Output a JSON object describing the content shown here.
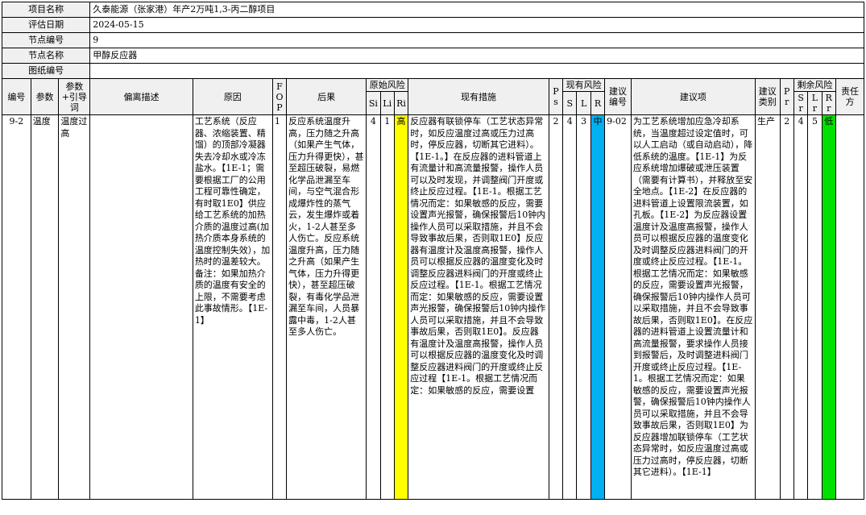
{
  "meta": {
    "project_label": "项目名称",
    "project_value": "久泰能源（张家港）年产2万吨1,3-丙二醇项目",
    "date_label": "评估日期",
    "date_value": "2024-05-15",
    "node_no_label": "节点编号",
    "node_no_value": "9",
    "node_name_label": "节点名称",
    "node_name_value": "甲醇反应器",
    "drawing_label": "图纸编号",
    "drawing_value": ""
  },
  "headers": {
    "no": "编号",
    "param": "参数",
    "param_guide": "参数+引导词",
    "deviation": "偏离描述",
    "cause": "原因",
    "fop": "FOP",
    "consequence": "后果",
    "orig_risk": "原始风险",
    "si": "Si",
    "li": "Li",
    "ri": "Ri",
    "measures": "现有措施",
    "ps": "Ps",
    "cur_risk": "现有风险",
    "s": "S",
    "l": "L",
    "r": "R",
    "rec_no": "建议编号",
    "rec": "建议项",
    "rec_type": "建议类别",
    "pr": "Pr",
    "res_risk": "剩余风险",
    "sr": "Sr",
    "lr": "Lr",
    "rr": "Rr",
    "owner": "责任方"
  },
  "row": {
    "no": "9-2",
    "param": "温度",
    "param_guide": "温度过高",
    "deviation": "",
    "cause": "工艺系统（反应器、浓缩装置、精馏）的顶部冷凝器失去冷却水或冷冻盐水。【1E-1；需要根据工厂的公用工程可靠性确定，有时取1E0】供应给工艺系统的加热介质的温度过高(加热介质本身系统的温度控制失效），加热时的温差较大。备注：如果加热介质的温度有安全的上限，不需要考虑此事故情形。【1E-1】",
    "fop": "1",
    "consequence": "反应系统温度升高，压力随之升高（如果产生气体，压力升得更快），甚至超压破裂，易燃化学品泄漏至车间，与空气混合形成爆炸性的蒸气云，发生爆炸或着火，1-2人甚至多人伤亡。反应系统温度升高，压力随之升高（如果产生气体，压力升得更快），甚至超压破裂，有毒化学品泄漏至车间，人员暴露中毒，1-2人甚至多人伤亡。",
    "si": "4",
    "li": "1",
    "ri": "高",
    "measures": "反应器有联锁停车（工艺状态异常时，如反应温度过高或压力过高时，停反应器，切断其它进料）。【1E-1。】在反应器的进料管道上有流量计和高流量报警，操作人员可以及时发现，并调整阀门开度或终止反应过程。【1E-1。根据工艺情况而定：如果敏感的反应，需要设置声光报警，确保报警后10钟内操作人员可以采取措施，并且不会导致事故后果，否则取1E0】反应器有温度计及温度高报警，操作人员可以根据反应器的温度变化及时调整反应器进料阀门的开度或终止反应过程。【1E-1。根据工艺情况而定：如果敏感的反应，需要设置声光报警，确保报警后10钟内操作人员可以采取措施，并且不会导致事故后果，否则取1E0】。反应器有温度计及温度高报警，操作人员可以根据反应器的温度变化及时调整反应器进料阀门的开度或终止反应过程【1E-1。根据工艺情况而定：如果敏感的反应，需要设置",
    "ps": "2",
    "s": "4",
    "l": "3",
    "r": "中",
    "rec_no": "9-02",
    "rec": "为工艺系统增加应急冷却系统，当温度超过设定值时，可以人工启动（或自动启动），降低系统的温度。【1E-1】为反应系统增加爆破或泄压装置（需要有计算书），并释放至安全地点。【1E-2】在反应器的进料管道上设置限流装置，如孔板。【1E-2】为反应器设置温度计及温度高报警，操作人员可以根据反应器的温度变化及时调整反应器进料阀门的开度或终止反应过程。【1E-1。根据工艺情况而定：如果敏感的反应，需要设置声光报警，确保报警后10钟内操作人员可以采取措施，并且不会导致事故后果，否则取1E0】。在反应器的进料管道上设置流量计和高流量报警，要求操作人员接到报警后，及时调整进料阀门开度或终止反应过程。【1E-1。根据工艺情况而定：如果敏感的反应，需要设置声光报警，确保报警后10钟内操作人员可以采取措施，并且不会导致事故后果，否则取1E0】为反应器增加联锁停车（工艺状态异常时，如反应温度过高或压力过高时，停反应器，切断其它进料）。【1E-1】",
    "rec_type": "生产",
    "pr": "2",
    "sr": "4",
    "lr": "5",
    "rr": "低",
    "owner": ""
  },
  "colors": {
    "orig_risk_high": "#ffff00",
    "cur_risk_mid": "#00b0f0",
    "res_risk_low": "#00e000"
  }
}
